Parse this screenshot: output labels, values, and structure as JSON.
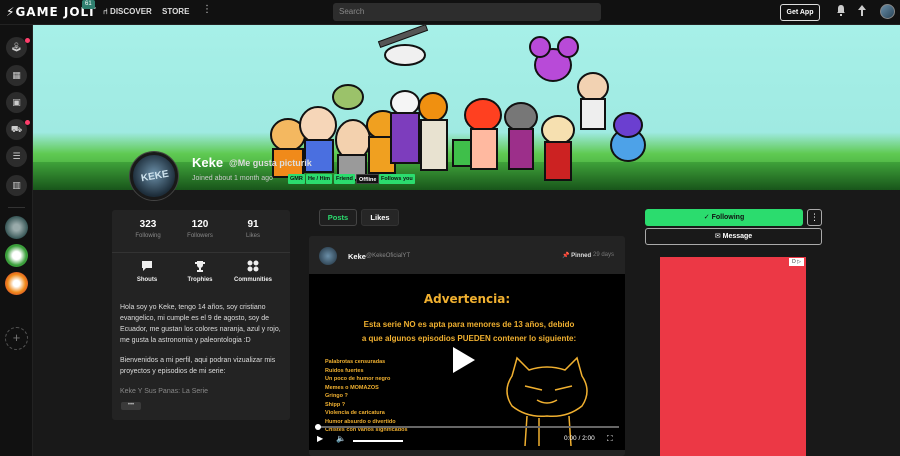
{
  "topbar": {
    "logo": "GAME JOLT",
    "logo_badge": "61",
    "discover": "DISCOVER",
    "store": "STORE",
    "more": "⋮",
    "search_placeholder": "Search",
    "get_app": "Get App"
  },
  "profile": {
    "name": "Keke",
    "username": "@Me gusta picturik",
    "joined": "Joined about 1 month ago",
    "avatar_text": "KEKE",
    "tags": [
      "GMR",
      "He / Him",
      "Friend",
      "Offline",
      "Follows you"
    ]
  },
  "stats": [
    {
      "value": "323",
      "label": "Following"
    },
    {
      "value": "120",
      "label": "Followers"
    },
    {
      "value": "91",
      "label": "Likes"
    }
  ],
  "actions": [
    {
      "label": "Shouts",
      "icon": "chat-icon"
    },
    {
      "label": "Trophies",
      "icon": "trophy-icon"
    },
    {
      "label": "Communities",
      "icon": "communities-icon"
    }
  ],
  "bio": {
    "p1": "Hola soy yo Keke, tengo 14 años, soy cristiano evangelico, mi cumple es el 9 de agosto, soy de Ecuador, me gustan los colores naranja, azul y rojo, me gusta la astronomia y paleontologia :D",
    "p2": "Bienvenidos a mi perfil, aqui podran vizualizar mis proyectos y episodios de mi serie:",
    "p3": "Keke Y Sus Panas: La Serie",
    "more": "•••"
  },
  "tabs": [
    "Posts",
    "Likes"
  ],
  "post": {
    "author": "Keke",
    "handle": "@KekeOficialYT",
    "pinned": "Pinned",
    "age": "29 days",
    "video": {
      "title": "Advertencia:",
      "line1": "Esta serie NO es apta para menores de 13 años, debido",
      "line2": "a que algunos episodios PUEDEN contener lo siguiente:",
      "list": [
        "Palabrotas censuradas",
        "Ruidos fuertes",
        "Un poco de humor negro",
        "Memes o MOMAZOS",
        "Gringo ?",
        "Shipp ?",
        "Violencia de caricatura",
        "Humor absurdo o divertido",
        "Chistes con varios significados"
      ],
      "time": "0:00 / 2:00",
      "progress": 0,
      "volume": 1
    }
  },
  "sidebar_right": {
    "following": "Following",
    "message": "Message",
    "ad_badge": "D ▷"
  },
  "colors": {
    "accent": "#2bdc6e",
    "ad_red": "#ec3845",
    "video_text": "#f0b030"
  }
}
